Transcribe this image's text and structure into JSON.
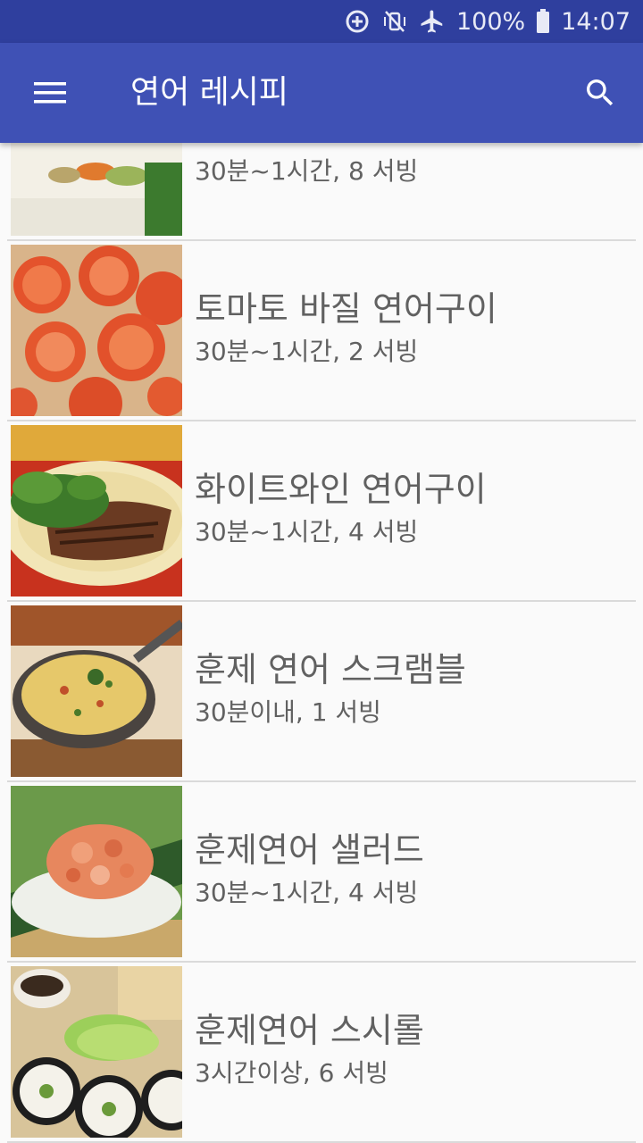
{
  "status_bar": {
    "icons": [
      "data-saver-icon",
      "vibrate-mute-icon",
      "airplane-icon",
      "battery-icon"
    ],
    "battery": "100%",
    "time": "14:07"
  },
  "app_bar": {
    "title": "연어 레시피",
    "menu_icon": "hamburger-menu-icon",
    "search_icon": "search-icon"
  },
  "recipes": [
    {
      "title": "",
      "meta": "30분~1시간, 8 서빙",
      "image": "sushi-roll-photo"
    },
    {
      "title": "토마토 바질 연어구이",
      "meta": "30분~1시간, 2 서빙",
      "image": "tomato-salmon-photo"
    },
    {
      "title": "화이트와인 연어구이",
      "meta": "30분~1시간, 4 서빙",
      "image": "grilled-salmon-plate-photo"
    },
    {
      "title": "훈제 연어 스크램블",
      "meta": "30분이내, 1 서빙",
      "image": "scramble-skillet-photo"
    },
    {
      "title": "훈제연어 샐러드",
      "meta": "30분~1시간, 4 서빙",
      "image": "salmon-salad-photo"
    },
    {
      "title": "훈제연어 스시롤",
      "meta": "3시간이상, 6 서빙",
      "image": "avocado-sushi-photo"
    }
  ]
}
